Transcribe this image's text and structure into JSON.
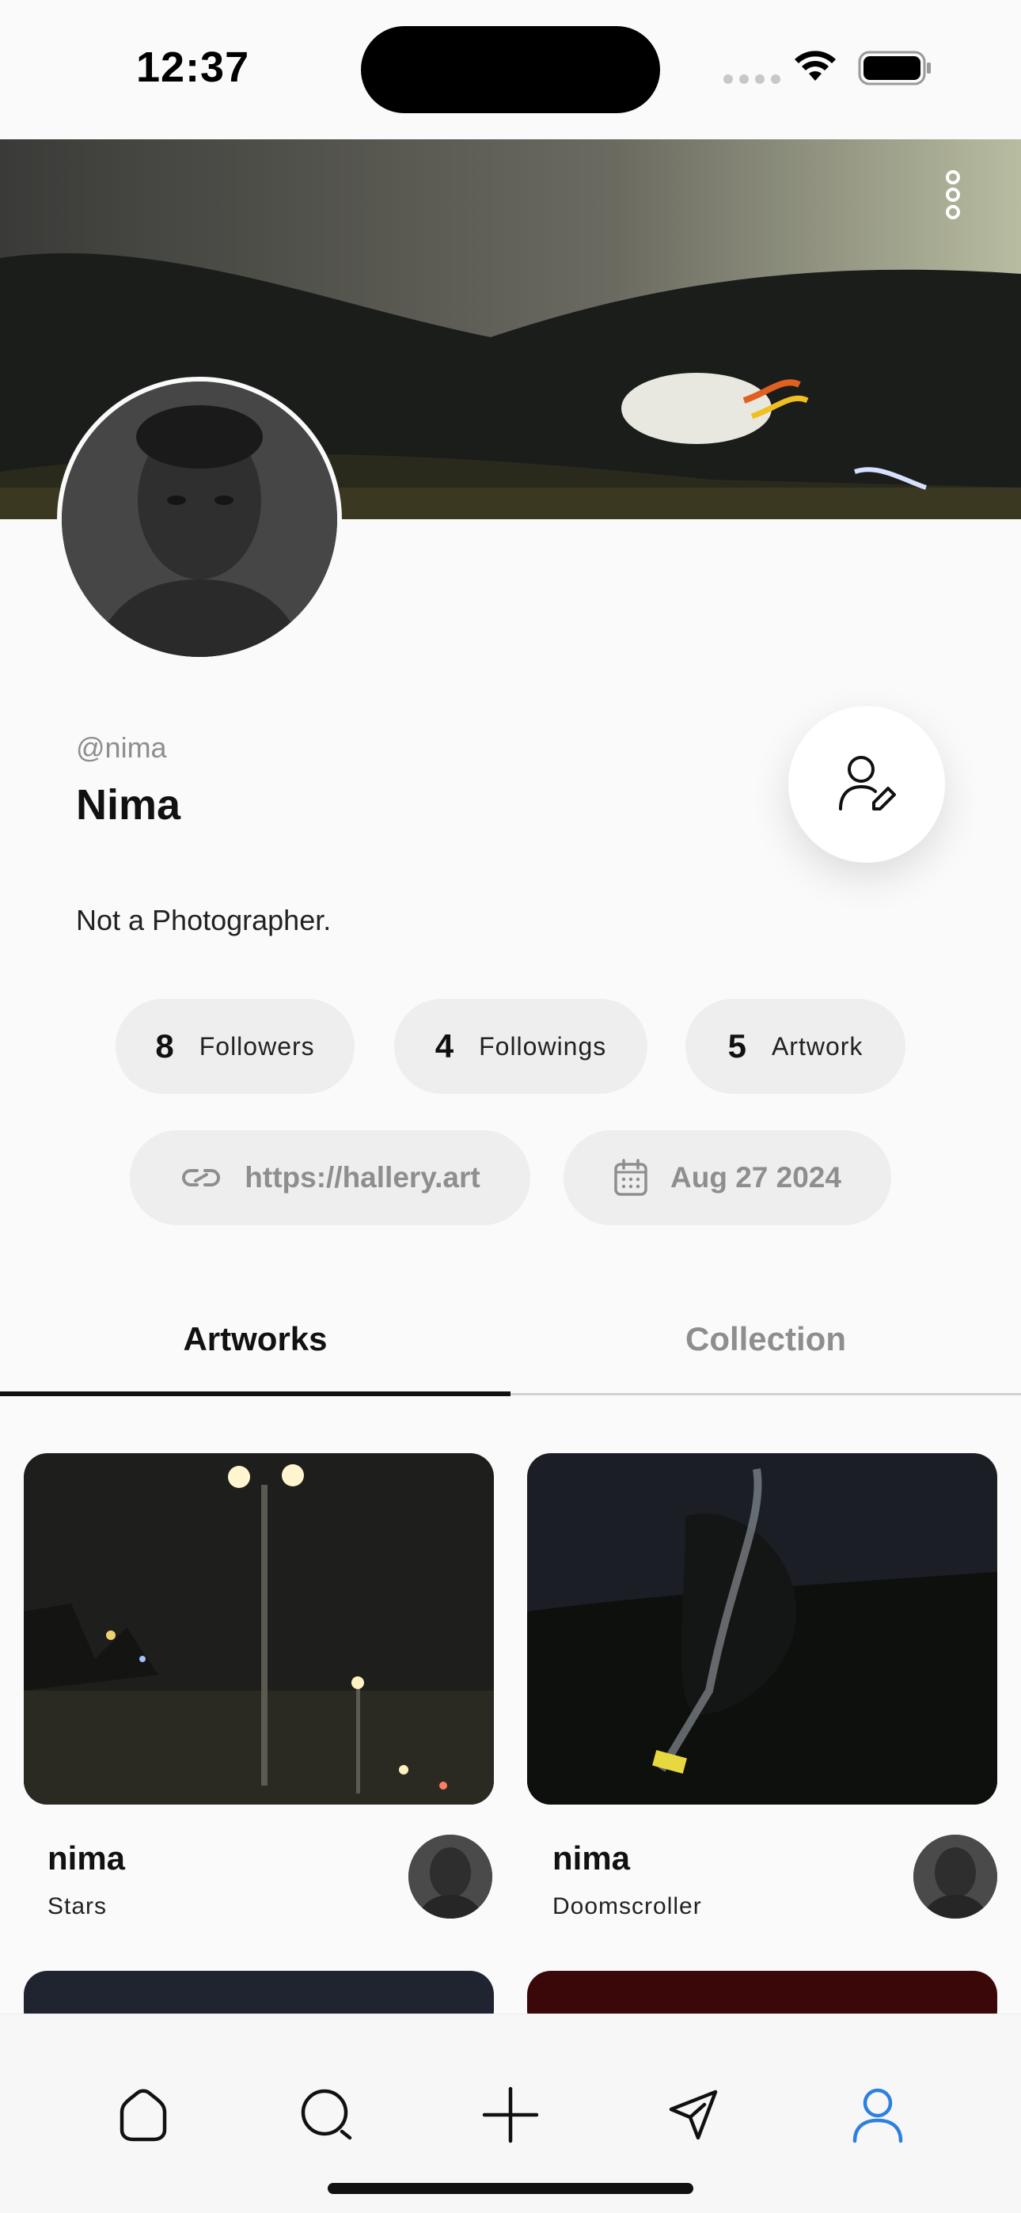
{
  "status_bar": {
    "time": "12:37"
  },
  "profile": {
    "handle": "@nima",
    "name": "Nima",
    "bio": "Not a Photographer."
  },
  "stats": [
    {
      "count": "8",
      "label": "Followers"
    },
    {
      "count": "4",
      "label": "Followings"
    },
    {
      "count": "5",
      "label": "Artwork"
    }
  ],
  "meta": {
    "link": "https://hallery.art",
    "joined": "Aug 27 2024"
  },
  "tabs": [
    {
      "label": "Artworks",
      "active": true
    },
    {
      "label": "Collection",
      "active": false
    }
  ],
  "artworks": [
    {
      "user": "nima",
      "title": "Stars"
    },
    {
      "user": "nima",
      "title": "Doomscroller"
    }
  ],
  "nav": {
    "items": [
      "home-icon",
      "search-icon",
      "plus-icon",
      "send-icon",
      "profile-icon"
    ],
    "active_color": "#2f7fe0"
  },
  "colors": {
    "accent": "#2f7fe0",
    "pill_bg": "#eeeeee",
    "muted_text": "#8e8e8e"
  }
}
